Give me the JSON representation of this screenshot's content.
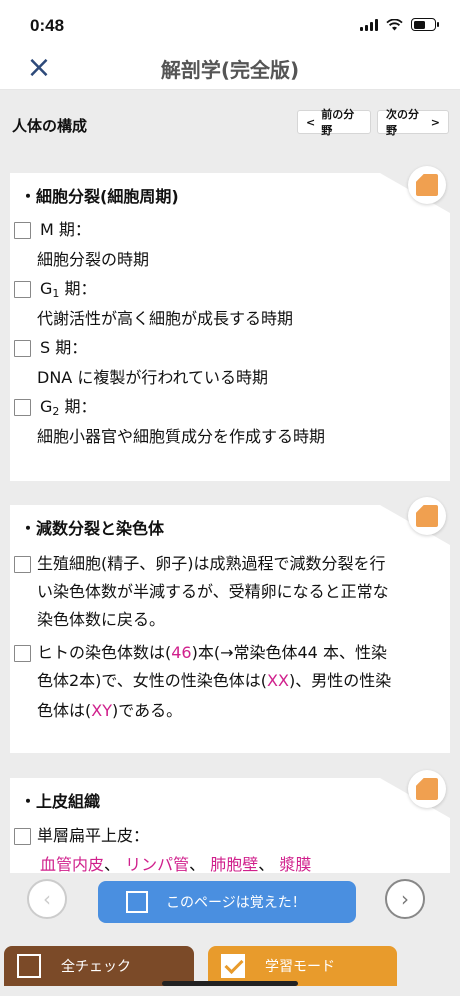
{
  "status": {
    "time": "0:48"
  },
  "nav": {
    "title": "解剖学(完全版)",
    "close_icon": "×"
  },
  "section": {
    "title": "人体の構成",
    "prev_label": "前の分野",
    "next_label": "次の分野",
    "prev_arrow": "<",
    "next_arrow": ">"
  },
  "cards": [
    {
      "title": "・細胞分裂(細胞周期)",
      "items": [
        {
          "term_a": "M 期：",
          "desc": "細胞分裂の時期"
        },
        {
          "term_a": "G",
          "term_sub": "1",
          "term_b": " 期：",
          "desc": "代謝活性が高く細胞が成長する時期"
        },
        {
          "term_a": "S 期：",
          "desc": "DNA に複製が行われている時期"
        },
        {
          "term_a": "G",
          "term_sub": "2",
          "term_b": " 期：",
          "desc": "細胞小器官や細胞質成分を作成する時期"
        }
      ]
    },
    {
      "title": "・減数分裂と染色体",
      "items": [
        {
          "lines": [
            "生殖細胞(精子、卵子)は成熟過程で減数分裂を行",
            "い染色体数が半減するが、受精卵になると正常な",
            "染色体数に戻る。"
          ]
        },
        {
          "line1_a": "ヒトの染色体数は(",
          "line1_pink": "46",
          "line1_b": ")本(→常染色体44 本、性染",
          "line2_a": "色体2本)で、女性の性染色体は(",
          "line2_pink": "XX",
          "line2_b": ")、男性の性染",
          "line3_a": "色体は(",
          "line3_pink": "XY",
          "line3_b": ")である。"
        }
      ]
    },
    {
      "title": "・上皮組織",
      "items": [
        {
          "term": "単層扁平上皮：",
          "examples": [
            "血管内皮",
            "、",
            "リンパ管",
            "、",
            "肺胞壁",
            "、",
            "漿膜"
          ]
        }
      ]
    }
  ],
  "bottom": {
    "memorized_label": "このページは覚えた！",
    "allcheck_label": "全チェック",
    "studymode_label": "学習モード",
    "left_arrow": "‹",
    "right_arrow": "›"
  },
  "colors": {
    "accent_blue": "#4a8fe0",
    "pink": "#d0208c",
    "brown": "#7b4a28",
    "orange": "#e89b2c"
  }
}
